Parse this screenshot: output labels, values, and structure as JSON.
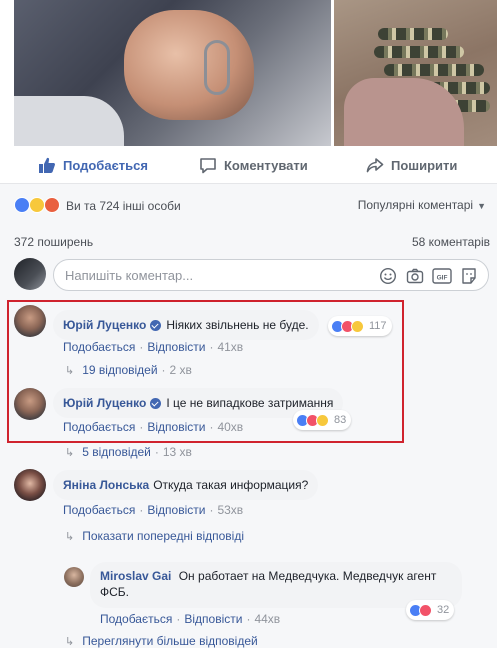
{
  "post_actions": {
    "like_label": "Подобається",
    "comment_label": "Коментувати",
    "share_label": "Поширити"
  },
  "reactions_summary": {
    "text": "Ви та 724 інші особи",
    "sort_label": "Популярні коментарі"
  },
  "stats": {
    "shares": "372 поширень",
    "comments": "58 коментарів"
  },
  "composer": {
    "placeholder": "Напишіть коментар..."
  },
  "comments": [
    {
      "author": "Юрій Луценко",
      "verified": true,
      "text": "Ніяких звільнень не буде.",
      "like": "Подобається",
      "reply": "Відповісти",
      "time": "41хв",
      "reaction_count": "117",
      "replies_label": "19 відповідей",
      "replies_time": "2 хв"
    },
    {
      "author": "Юрій Луценко",
      "verified": true,
      "text": "І це не випадкове затримання",
      "like": "Подобається",
      "reply": "Відповісти",
      "time": "40хв",
      "reaction_count": "83",
      "replies_label": "5 відповідей",
      "replies_time": "13 хв"
    },
    {
      "author": "Яніна Лонська",
      "verified": false,
      "text": "Откуда такая информация?",
      "like": "Подобається",
      "reply": "Відповісти",
      "time": "53хв",
      "show_previous": "Показати попередні відповіді"
    }
  ],
  "reply": {
    "author": "Miroslav Gai",
    "text": "Он работает на Медведчука. Медведчук агент ФСБ.",
    "like": "Подобається",
    "reply": "Відповісти",
    "time": "44хв",
    "reaction_count": "32",
    "more_label": "Переглянути більше відповідей"
  },
  "colors": {
    "link": "#385898",
    "facebook_blue": "#4267b2",
    "highlight": "#d0232e"
  }
}
